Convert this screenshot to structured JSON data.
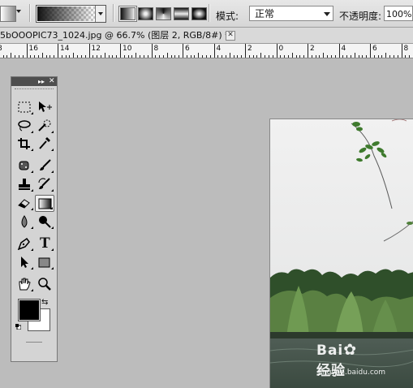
{
  "options_bar": {
    "tool_preset_icon": "gradient-tool-icon",
    "gradient_types": [
      "linear-gradient-icon",
      "radial-gradient-icon",
      "angle-gradient-icon",
      "reflected-gradient-icon",
      "diamond-gradient-icon"
    ],
    "mode_label": "模式:",
    "mode_value": "正常",
    "opacity_label": "不透明度:",
    "opacity_value": "100%"
  },
  "document_tab": {
    "title": "5bOOOPIC73_1024.jpg @ 66.7% (图层 2, RGB/8#) *",
    "close_label": "✕"
  },
  "ruler": {
    "labels": [
      "8",
      "16",
      "14",
      "12",
      "10",
      "8",
      "6",
      "4",
      "2",
      "0",
      "2",
      "4",
      "6",
      "8"
    ]
  },
  "toolbox": {
    "collapse_label": "▸▸",
    "close_label": "✕",
    "tools": [
      {
        "name": "marquee-tool-icon"
      },
      {
        "name": "move-tool-icon"
      },
      {
        "name": "lasso-tool-icon"
      },
      {
        "name": "quick-selection-tool-icon"
      },
      {
        "name": "crop-tool-icon"
      },
      {
        "name": "eyedropper-tool-icon"
      },
      {
        "name": "spot-healing-tool-icon"
      },
      {
        "name": "brush-tool-icon"
      },
      {
        "name": "clone-stamp-tool-icon"
      },
      {
        "name": "history-brush-tool-icon"
      },
      {
        "name": "eraser-tool-icon"
      },
      {
        "name": "gradient-tool-icon",
        "active": true
      },
      {
        "name": "blur-tool-icon"
      },
      {
        "name": "dodge-tool-icon"
      },
      {
        "name": "pen-tool-icon"
      },
      {
        "name": "type-tool-icon"
      },
      {
        "name": "path-selection-tool-icon"
      },
      {
        "name": "rectangle-tool-icon"
      },
      {
        "name": "hand-tool-icon"
      },
      {
        "name": "zoom-tool-icon"
      }
    ],
    "type_tool_glyph": "T",
    "foreground_color": "#000000",
    "background_color": "#ffffff"
  },
  "watermark": {
    "brand": "Bai",
    "brand_suffix": "经验",
    "url": "jingyan.baidu.com"
  }
}
